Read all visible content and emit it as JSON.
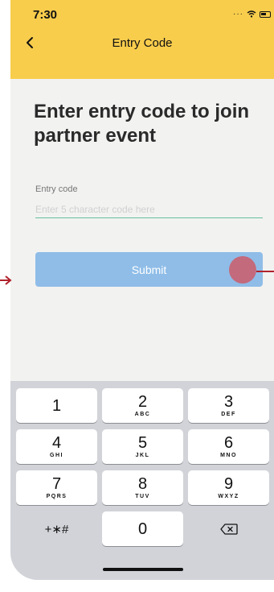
{
  "status_bar": {
    "time": "7:30",
    "signal": "···",
    "wifi_icon": "wifi-icon",
    "battery_icon": "battery-icon"
  },
  "nav": {
    "back_icon": "chevron-left-icon",
    "title": "Entry Code"
  },
  "heading": "Enter entry code to join partner event",
  "form": {
    "label": "Entry code",
    "value": "",
    "placeholder": "Enter 5 character code here",
    "submit_label": "Submit"
  },
  "keypad": {
    "keys": [
      {
        "num": "1",
        "letters": ""
      },
      {
        "num": "2",
        "letters": "ABC"
      },
      {
        "num": "3",
        "letters": "DEF"
      },
      {
        "num": "4",
        "letters": "GHI"
      },
      {
        "num": "5",
        "letters": "JKL"
      },
      {
        "num": "6",
        "letters": "MNO"
      },
      {
        "num": "7",
        "letters": "PQRS"
      },
      {
        "num": "8",
        "letters": "TUV"
      },
      {
        "num": "9",
        "letters": "WXYZ"
      }
    ],
    "symbols": "+∗#",
    "zero": "0",
    "delete_icon": "backspace-icon"
  },
  "colors": {
    "header": "#f8cd4c",
    "submit": "#8fbde8",
    "input_underline": "#66c19b",
    "touch_indicator": "#cd5c69",
    "annotation_arrow": "#b0222c"
  }
}
